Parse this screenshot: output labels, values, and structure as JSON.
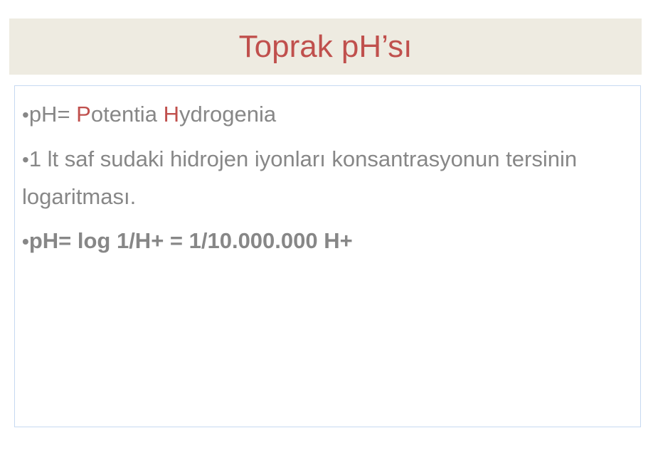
{
  "slide": {
    "title": "Toprak pH’sı",
    "accent_color": "#c0504d",
    "text_color": "#878787",
    "bullet_char": "•",
    "bullets": [
      {
        "prefix": "pH= ",
        "p_letter": "P",
        "p_rest": "otentia ",
        "h_letter": "H",
        "h_rest": "ydrogenia"
      },
      {
        "text": "1 lt saf sudaki hidrojen iyonları konsantrasyonun tersinin logaritması."
      },
      {
        "text": "pH= log 1/H+ =  1/10.000.000 H+"
      }
    ]
  }
}
